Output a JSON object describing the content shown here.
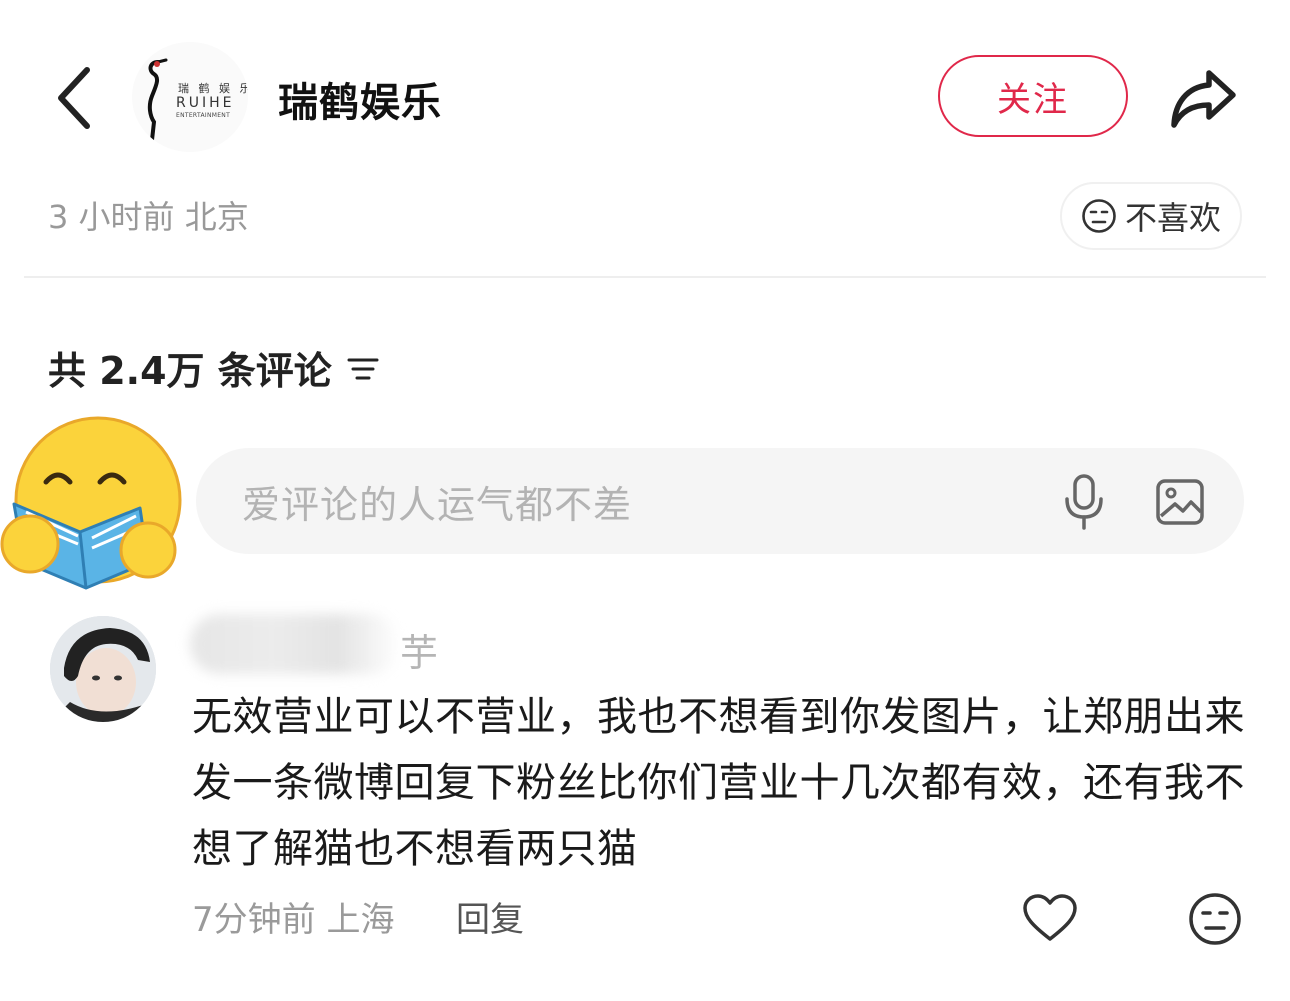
{
  "header": {
    "account_name": "瑞鹤娱乐",
    "logo_text_cn": "瑞 鹤 娱 乐",
    "logo_text_en": "RUIHE",
    "logo_text_sub": "ENTERTAINMENT",
    "follow_label": "关注",
    "back_icon": "chevron-left-icon",
    "share_icon": "share-arrow-icon"
  },
  "post_meta": {
    "time_location": "3 小时前  北京",
    "dislike_label": "不喜欢"
  },
  "comments_section": {
    "count_label": "共 2.4万 条评论",
    "input_placeholder": "爱评论的人运气都不差"
  },
  "comment": {
    "username": "芋",
    "text": "无效营业可以不营业，我也不想看到你发图片，让郑朋出来发一条微博回复下粉丝比你们营业十几次都有效，还有我不想了解猫也不想看两只猫",
    "time_location": "7分钟前  上海",
    "reply_label": "回复"
  },
  "colors": {
    "accent": "#e0284a",
    "muted_text": "#999999",
    "input_bg": "#f5f5f5"
  }
}
